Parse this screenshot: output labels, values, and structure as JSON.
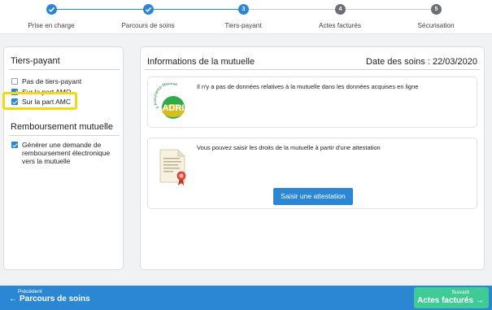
{
  "stepper": {
    "steps": [
      {
        "label": "Prise en charge",
        "number": "1",
        "state": "done"
      },
      {
        "label": "Parcours de soins",
        "number": "2",
        "state": "done"
      },
      {
        "label": "Tiers-payant",
        "number": "3",
        "state": "active"
      },
      {
        "label": "Actes facturés",
        "number": "4",
        "state": "todo"
      },
      {
        "label": "Sécurisation",
        "number": "5",
        "state": "todo"
      }
    ]
  },
  "left": {
    "tiers_payant_title": "Tiers-payant",
    "options": [
      {
        "label": "Pas de tiers-payant",
        "checked": false
      },
      {
        "label": "Sur la part AMO",
        "checked": true
      },
      {
        "label": "Sur la part AMC",
        "checked": true
      }
    ],
    "remboursement_title": "Remboursement mutuelle",
    "remboursement_option": {
      "label": "Générer une demande de remboursement électronique vers la mutuelle",
      "checked": true
    }
  },
  "right": {
    "title": "Informations de la mutuelle",
    "date": "Date des soins : 22/03/2020",
    "card1_text": "Il n'y a pas de données relatives à la mutuelle dans les données acquises en ligne",
    "card1_logo": {
      "text": "ADRI",
      "arc_text": "L'Assurance Maladie"
    },
    "card2_text": "Vous pouvez saisir les droits de la mutuelle à partir d'une attestation",
    "card2_button": "Saisir une attestation"
  },
  "footer": {
    "prev_small": "Précédent",
    "prev_label": "Parcours de soins",
    "next_small": "Suivant",
    "next_label": "Actes facturés",
    "prev_arrow": "←",
    "next_arrow": "→"
  },
  "colors": {
    "primary": "#2b87d3",
    "next_button": "#3fcb96",
    "highlight": "#f4d716",
    "step_todo": "#6b6f75"
  },
  "icons": {
    "step_done": "check-icon",
    "logo": "adri-logo",
    "document": "certificate-document-icon"
  }
}
